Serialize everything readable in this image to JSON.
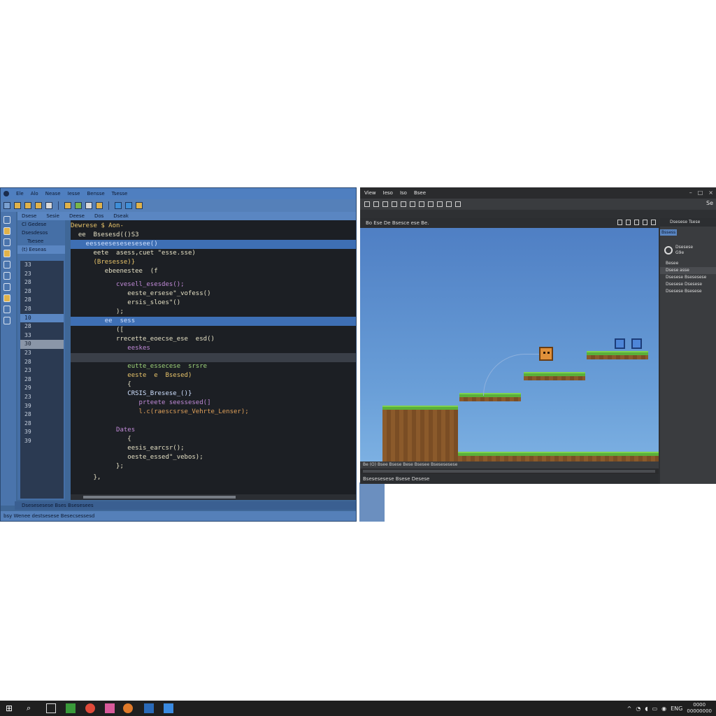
{
  "ide": {
    "menu": [
      "Ele",
      "Alo",
      "Nease",
      "Iesse",
      "Bensse",
      "Tsesse"
    ],
    "tabs": [
      "Dsese",
      "Sesie",
      "Deese",
      "Dos",
      "Dseak"
    ],
    "explorer": [
      "Cl Gedese",
      "Dsesdesos",
      "Tsesee",
      "(t) Eeseas"
    ],
    "line_numbers": [
      "33",
      "23",
      "28",
      "28",
      "28",
      "28",
      "10",
      "28",
      "33",
      "30",
      "23",
      "28",
      "23",
      "28",
      "29",
      "23",
      "39",
      "28",
      "28",
      "39",
      "39"
    ],
    "code_lines": [
      {
        "text": "Dewrese $ Aon-"
      },
      {
        "text": "  ee  Bsesesd(()S3"
      },
      {
        "text": "    eesseesesesesesee()"
      },
      {
        "text": "      eete  asess,cuet \"esse.sse)"
      },
      {
        "text": "      (Bresesse)}"
      },
      {
        "text": "         ebeenestee  (f"
      },
      {
        "text": "            cvesell_esesdes();"
      },
      {
        "text": "               eeste_ersese\"_vofess()"
      },
      {
        "text": "               ersis_sloes\"()"
      },
      {
        "text": "            );"
      },
      {
        "text": "         ee  sess"
      },
      {
        "text": "            ([ "
      },
      {
        "text": "            rrecette_eoecse_ese  esd()"
      },
      {
        "text": "               eeskes"
      },
      {
        "text": "               eutte_essecese  srsre"
      },
      {
        "text": "               eeste  e  Bsesed)"
      },
      {
        "text": "               {"
      },
      {
        "text": "               CRSIS_Bresese_()}"
      },
      {
        "text": "                  prteete seessesed(]"
      },
      {
        "text": "                  l.c(raescsrse_Vehrte_Lenser);"
      },
      {
        "text": "            Dates"
      },
      {
        "text": "               {"
      },
      {
        "text": "               eesis_earcsr();"
      },
      {
        "text": "               oeste_essed\"_vebos);"
      },
      {
        "text": "            };"
      },
      {
        "text": "      },"
      }
    ],
    "bottom_tab": "Dsesesesese Bses Bsesesees",
    "status": "bsy Wenee destsesese Besecsessesd"
  },
  "engine": {
    "menu": [
      "View",
      "Ieso",
      "Iso",
      "Bsee"
    ],
    "toolbar_right": "Se",
    "view_label": "Bo  Ese  De  Bsesce  ese  Be.",
    "right_panel": {
      "header": "Dsesese Tsese",
      "selected_tab": "Bssess",
      "label_top": "Dsesese",
      "label_sub": "G9e",
      "section": "Besee",
      "items": [
        "Dsese  asse",
        "Dsesese Bsesesese",
        "Dsesese Dsesese",
        "Dsesese Bsesese"
      ]
    },
    "timeline_label": "Be  (O)  Bsee  Bsese  Bese  Bsesee  Bsesesesese",
    "footer": "Bsesesesese  Bsese  Desese"
  },
  "taskbar": {
    "clock_time": "0000",
    "clock_date": "00000000",
    "tray_text": "ENG"
  },
  "colors": {
    "ide_bg": "#3f6797",
    "editor_bg": "#1c1f24",
    "highlight": "#3e6fb4",
    "sky": "#6a9fd8",
    "grass": "#5ab03a",
    "dirt": "#8b5a2b"
  }
}
